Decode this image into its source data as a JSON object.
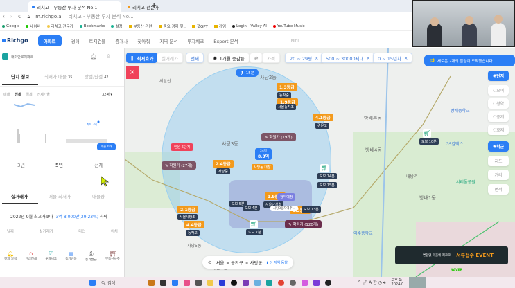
{
  "browser": {
    "tabs": [
      {
        "label": "리치고 - 부동산 투자 분석 No.1",
        "active": true
      },
      {
        "label": "리치고 전문가",
        "active": false
      }
    ],
    "new_tab": "+",
    "url": "m.richgo.ai",
    "page_title": "리치고 - 부동산 투자 분석 No.1",
    "bookmarks": [
      {
        "label": "Google",
        "color": "#1a9e6e"
      },
      {
        "label": "네이버",
        "color": "#1ec800"
      },
      {
        "label": "리치고 전문가",
        "color": "#f2c94c"
      },
      {
        "label": "Bookmarks",
        "color": "#1ab394"
      },
      {
        "label": "설정",
        "color": "#1ab394"
      },
      {
        "label": "부동산 관련",
        "folder": true
      },
      {
        "label": "중요 경제 및..",
        "folder": true
      },
      {
        "label": "챗GPT",
        "folder": true
      },
      {
        "label": "게임",
        "folder": true
      },
      {
        "label": "Login - Valley AI",
        "color": "#222"
      },
      {
        "label": "YouTube Music",
        "color": "#e00"
      }
    ]
  },
  "appnav": {
    "logo": "Richgo",
    "items": [
      "아파트",
      "경매",
      "토지건물",
      "중개사",
      "찾아줘",
      "지역 분석",
      "투자체크",
      "Expert 분석"
    ],
    "active": 0,
    "mini": "Mini"
  },
  "left": {
    "complex_name": "래미안로이파크",
    "tabs": [
      {
        "label": "단지 정보"
      },
      {
        "label": "최저가 매물",
        "count": "35"
      },
      {
        "label": "장점/단점",
        "count": "42"
      }
    ],
    "subtabs": [
      "매매",
      "전세",
      "월세",
      "전세가율"
    ],
    "area_select": "32평 ▾",
    "chart_button": "매물 0개",
    "chart_note": "최저 3억",
    "ranges": [
      "3년",
      "5년",
      "전체"
    ],
    "trade_tabs": [
      "실거래가",
      "매물 최저가",
      "매물량"
    ],
    "summary_prefix": "2022년 9월 최고가보다 ",
    "summary_value": "-3억 8,000만(29.23%)",
    "summary_suffix": " 하락",
    "columns": [
      "날짜",
      "실거래가",
      "타입",
      "위치"
    ],
    "bottom": [
      "단지 알림",
      "안심전세",
      "투자체크",
      "등기변동",
      "등기발급",
      "부동산사주"
    ]
  },
  "map": {
    "filters": {
      "main": "최저호가",
      "trade": "실거래가",
      "type": "전세",
      "period": "1개월 증감률",
      "price": "가격",
      "area": "20 ~ 29평",
      "households": "500 ~ 30000세대",
      "age": "0 ~ 15년차"
    },
    "walk": "15분",
    "notification": "새로운 2개의 알림이 도착했습니다.",
    "side": [
      "단지",
      "오피",
      "청약",
      "중개",
      "호재",
      "학군",
      "지도",
      "거리",
      "면적"
    ],
    "grades": [
      {
        "t": "1.3등급",
        "s": "동작중"
      },
      {
        "t": "1.9등급",
        "s": "서울동작초"
      },
      {
        "t": "4.1등급",
        "s": "경문고"
      },
      {
        "t": "2.4등급",
        "s": "사당중"
      },
      {
        "t": "1.9등급",
        "s": "서울남성초"
      },
      {
        "t": "2.1등급",
        "s": "서울사당초"
      },
      {
        "t": "4.4등급",
        "s": "동작고"
      },
      {
        "t": "5.3등급",
        "s": ""
      }
    ],
    "academies": [
      "학원가 (19개)",
      "학원가 (27개)",
      "학원가 (120개)"
    ],
    "safety": "인원  6단계",
    "price": {
      "top": "24평",
      "value": "8.3억",
      "label": "사당동 대장"
    },
    "subscription": "청약예정",
    "place": "사당3동지역주…",
    "dosi": [
      "도보 10분",
      "도보 14분",
      "도보 15분",
      "도보 5분",
      "도보 4분",
      "도보 13분",
      "도보 7분"
    ],
    "labels": [
      "사당2동",
      "사당3동",
      "사당5동",
      "사당1동",
      "방배4동",
      "방배1동",
      "방배본동",
      "서달산",
      "방배중학교",
      "이수중학교",
      "GS칼텍스",
      "내방역",
      "서리풀공원"
    ],
    "breadcrumb": "서울 > 동작구 > 사당동",
    "trend": "이 지역 동향",
    "ad": {
      "t1": "변함없 마을에 리크로",
      "t2": "서류접수 EVENT"
    },
    "naver": "NAVER"
  },
  "taskbar": {
    "search": "검색",
    "time": "오후 1:",
    "date": "2024-0"
  }
}
